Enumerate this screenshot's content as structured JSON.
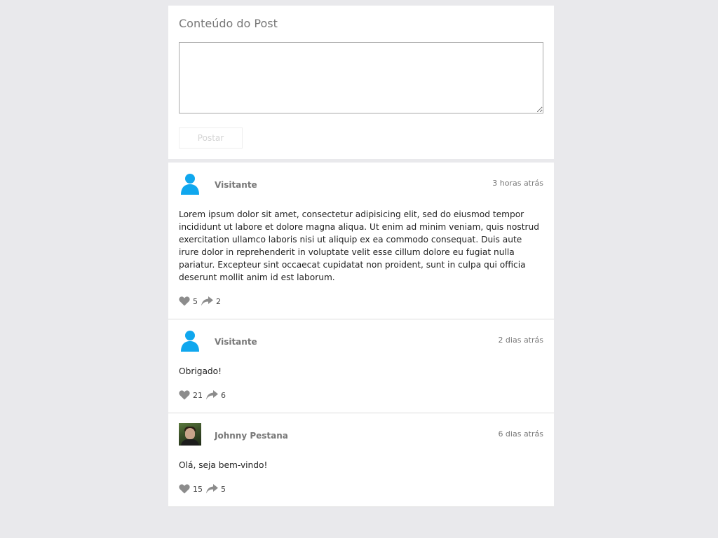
{
  "composer": {
    "title": "Conteúdo do Post",
    "textarea_value": "",
    "button_label": "Postar"
  },
  "posts": [
    {
      "author": "Visitante",
      "time": "3 horas atrás",
      "avatar": "user-silhouette-icon",
      "body": "Lorem ipsum dolor sit amet, consectetur adipisicing elit, sed do eiusmod tempor incididunt ut labore et dolore magna aliqua. Ut enim ad minim veniam, quis nostrud exercitation ullamco laboris nisi ut aliquip ex ea commodo consequat. Duis aute irure dolor in reprehenderit in voluptate velit esse cillum dolore eu fugiat nulla pariatur. Excepteur sint occaecat cupidatat non proident, sunt in culpa qui officia deserunt mollit anim id est laborum.",
      "likes": "5",
      "shares": "2"
    },
    {
      "author": "Visitante",
      "time": "2 dias atrás",
      "avatar": "user-silhouette-icon",
      "body": "Obrigado!",
      "likes": "21",
      "shares": "6"
    },
    {
      "author": "Johnny Pestana",
      "time": "6 dias atrás",
      "avatar": "user-photo",
      "body": "Olá, seja bem-vindo!",
      "likes": "15",
      "shares": "5"
    }
  ],
  "colors": {
    "page_background": "#e9e9ec",
    "card_background": "#ffffff",
    "avatar_blue": "#10a7ee",
    "icon_gray": "#8c8c8c",
    "muted_text": "#777777"
  },
  "icons": {
    "like": "heart-icon",
    "share": "share-arrow-icon"
  }
}
